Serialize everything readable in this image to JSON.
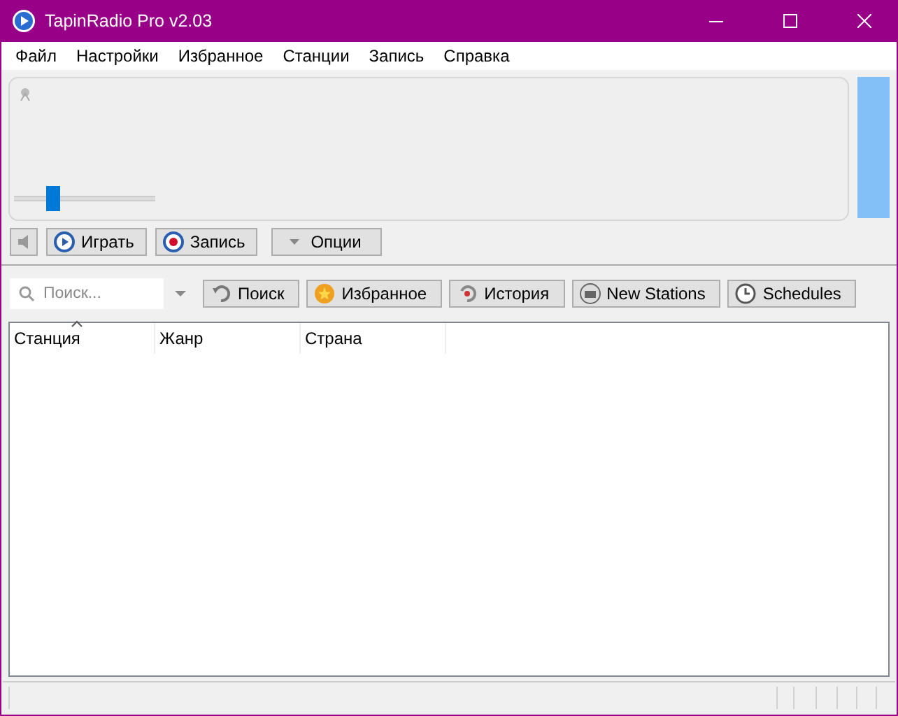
{
  "window": {
    "title": "TapinRadio Pro v2.03"
  },
  "menu": [
    "Файл",
    "Настройки",
    "Избранное",
    "Станции",
    "Запись",
    "Справка"
  ],
  "player": {
    "volume": {
      "level": 0.28
    }
  },
  "controls": [
    {
      "kind": "play",
      "label": "Играть"
    },
    {
      "kind": "record",
      "label": "Запись"
    },
    {
      "kind": "options",
      "label": "Опции"
    }
  ],
  "search": {
    "placeholder": "Поиск..."
  },
  "tabs": [
    {
      "kind": "search",
      "label": "Поиск"
    },
    {
      "kind": "favorites",
      "label": "Избранное"
    },
    {
      "kind": "history",
      "label": "История"
    },
    {
      "kind": "new",
      "label": "New Stations"
    },
    {
      "kind": "schedules",
      "label": "Schedules"
    }
  ],
  "table": {
    "columns": [
      {
        "label": "Станция",
        "sorted": true
      },
      {
        "label": "Жанр",
        "sorted": false
      },
      {
        "label": "Страна",
        "sorted": false
      }
    ]
  }
}
